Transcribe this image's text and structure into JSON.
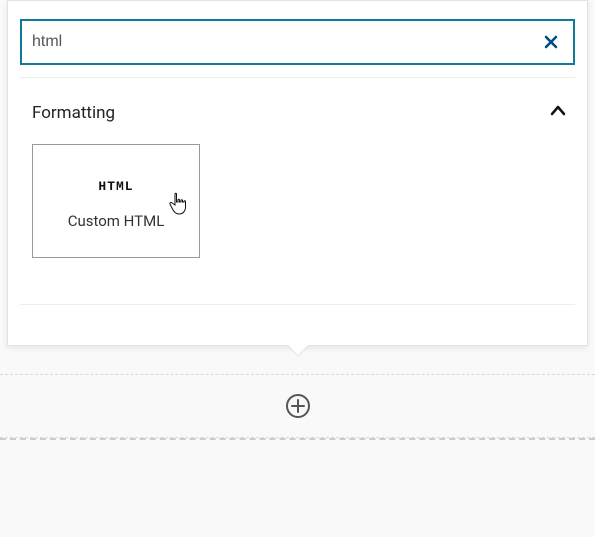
{
  "search": {
    "value": "html",
    "placeholder": ""
  },
  "section": {
    "title": "Formatting"
  },
  "blocks": [
    {
      "icon_text": "HTML",
      "label": "Custom HTML"
    }
  ],
  "colors": {
    "search_border": "#0e7b9b"
  }
}
